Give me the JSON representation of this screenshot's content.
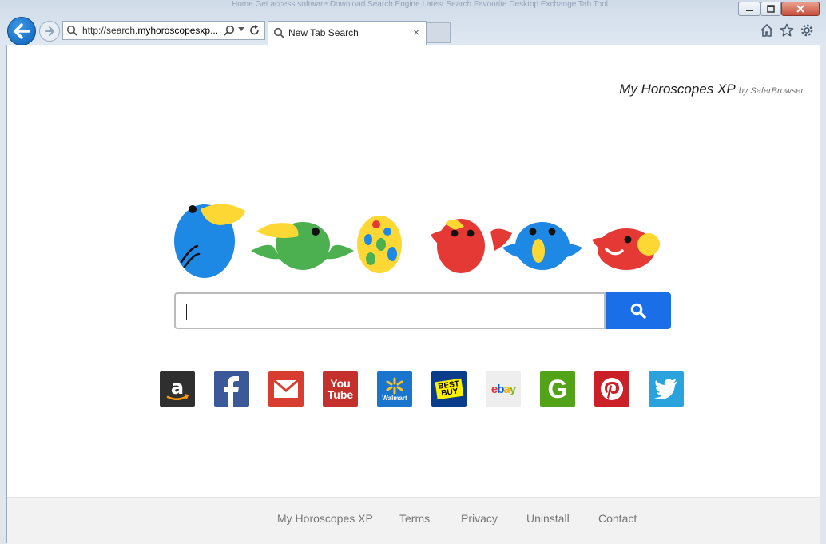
{
  "browser": {
    "address_url_prefix": "http://search.",
    "address_url_domain": "myhoroscopesxp...",
    "tab_title": "New Tab Search",
    "tab_close_glyph": "×",
    "background_ghost_text": "Home   Get access software   Download Search Engine Latest Search Favourite Desktop Exchange Tab Tool",
    "icons": [
      "back-arrow-icon",
      "forward-arrow-icon",
      "search-icon",
      "refresh-icon",
      "home-icon",
      "star-icon",
      "gear-icon"
    ]
  },
  "page": {
    "brand": {
      "name": "My Horoscopes XP",
      "by": "by SaferBrowser"
    },
    "search": {
      "placeholder": ""
    },
    "shortcuts": [
      {
        "name": "Amazon",
        "color": "#2f2f2f"
      },
      {
        "name": "Facebook",
        "color": "#3b5998"
      },
      {
        "name": "Gmail",
        "color": "#d93c31"
      },
      {
        "name": "YouTube",
        "color": "#c4302b"
      },
      {
        "name": "Walmart",
        "color": "#1a75cf"
      },
      {
        "name": "Best Buy",
        "color": "#0a3c8c"
      },
      {
        "name": "eBay",
        "color": "#eeeeee"
      },
      {
        "name": "Groupon",
        "color": "#53a318"
      },
      {
        "name": "Pinterest",
        "color": "#cb2027"
      },
      {
        "name": "Twitter",
        "color": "#2aa3dd"
      }
    ],
    "shortcut_text": {
      "youtube_you": "You",
      "youtube_tube": "Tube",
      "walmart": "Walmart",
      "bestbuy_1": "BEST",
      "bestbuy_2": "BUY",
      "ebay_e": "e",
      "ebay_b": "b",
      "ebay_a": "a",
      "ebay_y": "y",
      "groupon_g": "G"
    },
    "footer": {
      "links": [
        "My Horoscopes XP",
        "Terms",
        "Privacy",
        "Uninstall",
        "Contact"
      ]
    }
  }
}
